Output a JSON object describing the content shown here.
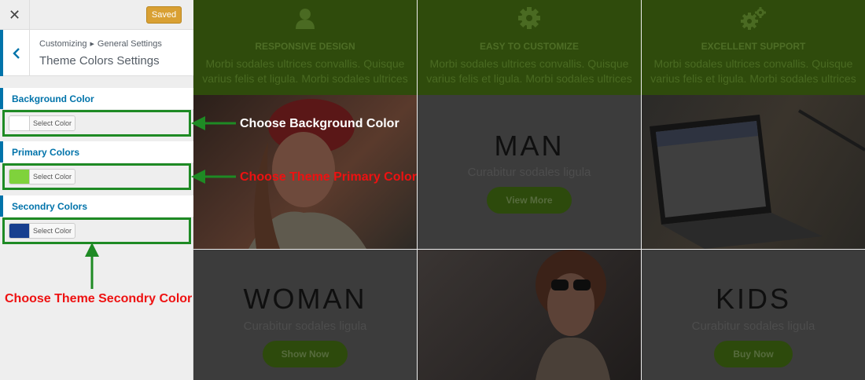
{
  "sidebar": {
    "close_icon": "close-icon",
    "saved_label": "Saved",
    "saved_color": "#d9a033",
    "breadcrumb_root": "Customizing",
    "breadcrumb_current": "General Settings",
    "title": "Theme Colors Settings",
    "sections": [
      {
        "label": "Background Color",
        "button_label": "Select Color",
        "swatch": "#ffffff"
      },
      {
        "label": "Primary Colors",
        "button_label": "Select Color",
        "swatch": "#7fd23c"
      },
      {
        "label": "Secondry Colors",
        "button_label": "Select Color",
        "swatch": "#173f8f"
      }
    ]
  },
  "preview": {
    "features": [
      {
        "icon": "user-icon",
        "title": "RESPONSIVE DESIGN",
        "text": "Morbi sodales ultrices convallis. Quisque varius felis et ligula. Morbi sodales ultrices"
      },
      {
        "icon": "gear-icon",
        "title": "EASY TO CUSTOMIZE",
        "text": "Morbi sodales ultrices convallis. Quisque varius felis et ligula. Morbi sodales ultrices"
      },
      {
        "icon": "gears-icon",
        "title": "EXCELLENT SUPPORT",
        "text": "Morbi sodales ultrices convallis. Quisque varius felis et ligula. Morbi sodales ultrices"
      }
    ],
    "tiles": {
      "man": {
        "heading": "MAN",
        "sub": "Curabitur sodales ligula",
        "button": "View More"
      },
      "woman": {
        "heading": "WOMAN",
        "sub": "Curabitur sodales ligula",
        "button": "Show Now"
      },
      "kids": {
        "heading": "KIDS",
        "sub": "Curabitur sodales ligula",
        "button": "Buy Now"
      }
    }
  },
  "annotations": {
    "background": "Choose Background Color",
    "primary": "Choose Theme Primary Color",
    "secondary": "Choose Theme Secondry Color"
  },
  "colors": {
    "accent_blue": "#0073aa",
    "highlight_green": "#1e8a24",
    "annotation_red": "#ee1111",
    "preview_green": "#2f4b0c"
  }
}
